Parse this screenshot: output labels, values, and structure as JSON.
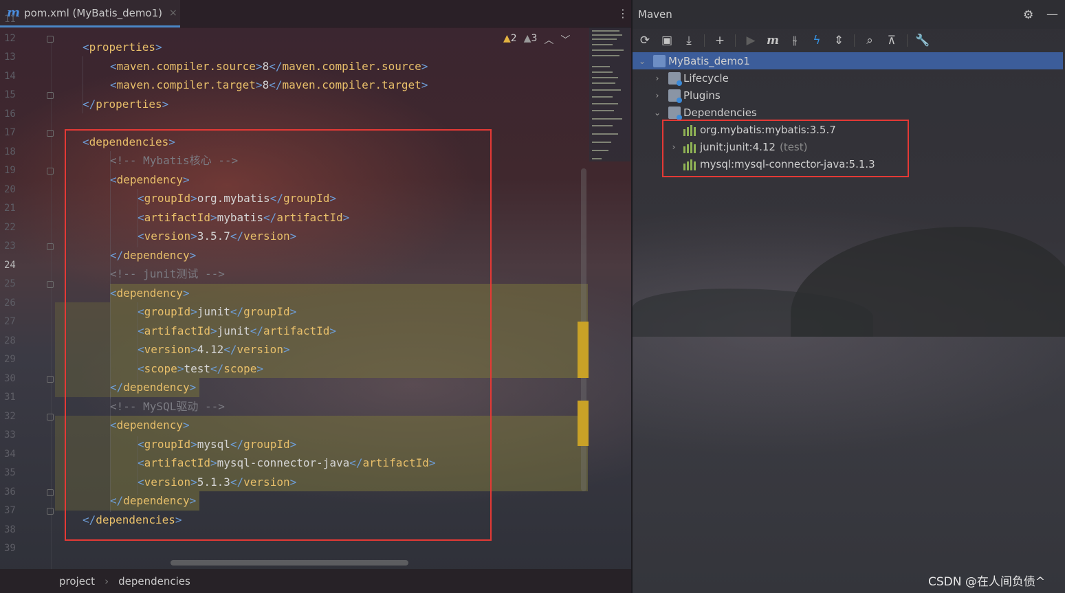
{
  "editor": {
    "tab_title": "pom.xml (MyBatis_demo1)",
    "tab_close": "×",
    "more_menu": "⋮",
    "inspections": {
      "warnings": "2",
      "weak_warnings": "3",
      "up": "︿",
      "down": "﹀"
    },
    "line_numbers": [
      "11",
      "12",
      "13",
      "14",
      "15",
      "16",
      "17",
      "18",
      "19",
      "20",
      "21",
      "22",
      "23",
      "24",
      "25",
      "26",
      "27",
      "28",
      "29",
      "30",
      "31",
      "32",
      "33",
      "34",
      "35",
      "36",
      "37",
      "38",
      "39"
    ],
    "current_line": "24",
    "lines": [
      {
        "indent": 1,
        "kind": "tag",
        "text": "<properties>"
      },
      {
        "indent": 2,
        "kind": "elem",
        "tag": "maven.compiler.source",
        "value": "8"
      },
      {
        "indent": 2,
        "kind": "elem",
        "tag": "maven.compiler.target",
        "value": "8"
      },
      {
        "indent": 1,
        "kind": "tag",
        "text": "</properties>"
      },
      {
        "indent": 0,
        "kind": "blank",
        "text": ""
      },
      {
        "indent": 1,
        "kind": "tag",
        "text": "<dependencies>"
      },
      {
        "indent": 2,
        "kind": "comment",
        "text": "<!-- Mybatis核心 -->"
      },
      {
        "indent": 2,
        "kind": "tag",
        "text": "<dependency>"
      },
      {
        "indent": 3,
        "kind": "elem",
        "tag": "groupId",
        "value": "org.mybatis"
      },
      {
        "indent": 3,
        "kind": "elem",
        "tag": "artifactId",
        "value": "mybatis"
      },
      {
        "indent": 3,
        "kind": "elem",
        "tag": "version",
        "value": "3.5.7"
      },
      {
        "indent": 2,
        "kind": "tag",
        "text": "</dependency>"
      },
      {
        "indent": 2,
        "kind": "comment",
        "text": "<!-- junit测试 -->"
      },
      {
        "indent": 2,
        "kind": "tag",
        "text": "<dependency>"
      },
      {
        "indent": 3,
        "kind": "elem",
        "tag": "groupId",
        "value": "junit"
      },
      {
        "indent": 3,
        "kind": "elem",
        "tag": "artifactId",
        "value": "junit"
      },
      {
        "indent": 3,
        "kind": "elem",
        "tag": "version",
        "value": "4.12"
      },
      {
        "indent": 3,
        "kind": "elem",
        "tag": "scope",
        "value": "test"
      },
      {
        "indent": 2,
        "kind": "tag",
        "text": "</dependency>"
      },
      {
        "indent": 2,
        "kind": "comment",
        "text": "<!-- MySQL驱动 -->"
      },
      {
        "indent": 2,
        "kind": "tag",
        "text": "<dependency>"
      },
      {
        "indent": 3,
        "kind": "elem",
        "tag": "groupId",
        "value": "mysql"
      },
      {
        "indent": 3,
        "kind": "elem",
        "tag": "artifactId",
        "value": "mysql-connector-java"
      },
      {
        "indent": 3,
        "kind": "elem",
        "tag": "version",
        "value": "5.1.3"
      },
      {
        "indent": 2,
        "kind": "tag",
        "text": "</dependency>"
      },
      {
        "indent": 1,
        "kind": "tag",
        "text": "</dependencies>"
      },
      {
        "indent": 0,
        "kind": "blank",
        "text": ""
      },
      {
        "indent": 0,
        "kind": "blank",
        "text": ""
      }
    ],
    "breadcrumb": [
      "project",
      "dependencies"
    ],
    "breadcrumb_sep": "›"
  },
  "maven": {
    "title": "Maven",
    "gear_icon": "⚙",
    "minimize_icon": "—",
    "toolbar": [
      {
        "name": "reload-icon",
        "glyph": "⟳"
      },
      {
        "name": "generate-sources-icon",
        "glyph": "▣"
      },
      {
        "name": "download-icon",
        "glyph": "⤓"
      },
      {
        "name": "sep"
      },
      {
        "name": "add-icon",
        "glyph": "+"
      },
      {
        "name": "sep"
      },
      {
        "name": "run-icon",
        "glyph": "▶"
      },
      {
        "name": "execute-goal-icon",
        "glyph": "m"
      },
      {
        "name": "toggle-offline-icon",
        "glyph": "⫳"
      },
      {
        "name": "skip-tests-icon",
        "glyph": "ϟ"
      },
      {
        "name": "collapse-all-icon",
        "glyph": "⇕"
      },
      {
        "name": "sep"
      },
      {
        "name": "show-dependencies-icon",
        "glyph": "⌕"
      },
      {
        "name": "expand-icon",
        "glyph": "⊼"
      },
      {
        "name": "sep"
      },
      {
        "name": "settings-wrench-icon",
        "glyph": "🔧"
      }
    ],
    "tree": {
      "project": "MyBatis_demo1",
      "lifecycle": "Lifecycle",
      "plugins": "Plugins",
      "dependencies": "Dependencies",
      "deps": [
        {
          "label": "org.mybatis:mybatis:3.5.7",
          "note": "",
          "expandable": false
        },
        {
          "label": "junit:junit:4.12",
          "note": "(test)",
          "expandable": true
        },
        {
          "label": "mysql:mysql-connector-java:5.1.3",
          "note": "",
          "expandable": false
        }
      ]
    }
  },
  "watermark": "CSDN @在人间负债^",
  "colors": {
    "highlight_box": "#e53935",
    "selection": "#3c5d9a",
    "accent": "#4a88c7"
  }
}
